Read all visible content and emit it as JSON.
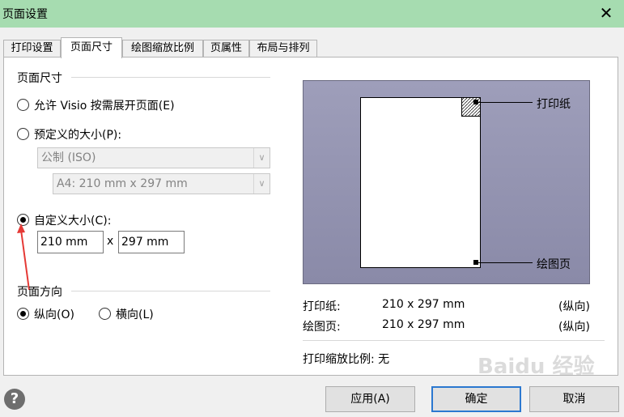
{
  "window": {
    "title": "页面设置",
    "close_glyph": "✕"
  },
  "tabs": [
    {
      "label": "打印设置",
      "active": false
    },
    {
      "label": "页面尺寸",
      "active": true
    },
    {
      "label": "绘图缩放比例",
      "active": false
    },
    {
      "label": "页属性",
      "active": false
    },
    {
      "label": "布局与排列",
      "active": false
    }
  ],
  "page_size": {
    "section_title": "页面尺寸",
    "options": [
      {
        "label": "允许 Visio 按需展开页面(E)",
        "checked": false
      },
      {
        "label": "预定义的大小(P):",
        "checked": false
      },
      {
        "label": "自定义大小(C):",
        "checked": true
      }
    ],
    "predefined_standard": "公制 (ISO)",
    "predefined_size": "A4:  210 mm x 297 mm",
    "custom_width": "210 mm",
    "custom_separator": "x",
    "custom_height": "297 mm"
  },
  "orientation": {
    "section_title": "页面方向",
    "portrait_label": "纵向(O)",
    "portrait_checked": true,
    "landscape_label": "横向(L)",
    "landscape_checked": false
  },
  "preview": {
    "printer_paper_callout": "打印纸",
    "drawing_page_callout": "绘图页"
  },
  "info": {
    "printer_paper_label": "打印纸:",
    "printer_paper_size": "210 x 297 mm",
    "printer_paper_orientation": "(纵向)",
    "drawing_page_label": "绘图页:",
    "drawing_page_size": "210 x 297 mm",
    "drawing_page_orientation": "(纵向)",
    "print_zoom": "打印缩放比例: 无"
  },
  "buttons": {
    "apply": "应用(A)",
    "ok": "确定",
    "cancel": "取消",
    "help": "?"
  },
  "watermark": "Baidu 经验",
  "colors": {
    "titlebar": "#a6dcb0",
    "annotation_arrow": "#e53935",
    "default_button_border": "#2b78d0"
  }
}
